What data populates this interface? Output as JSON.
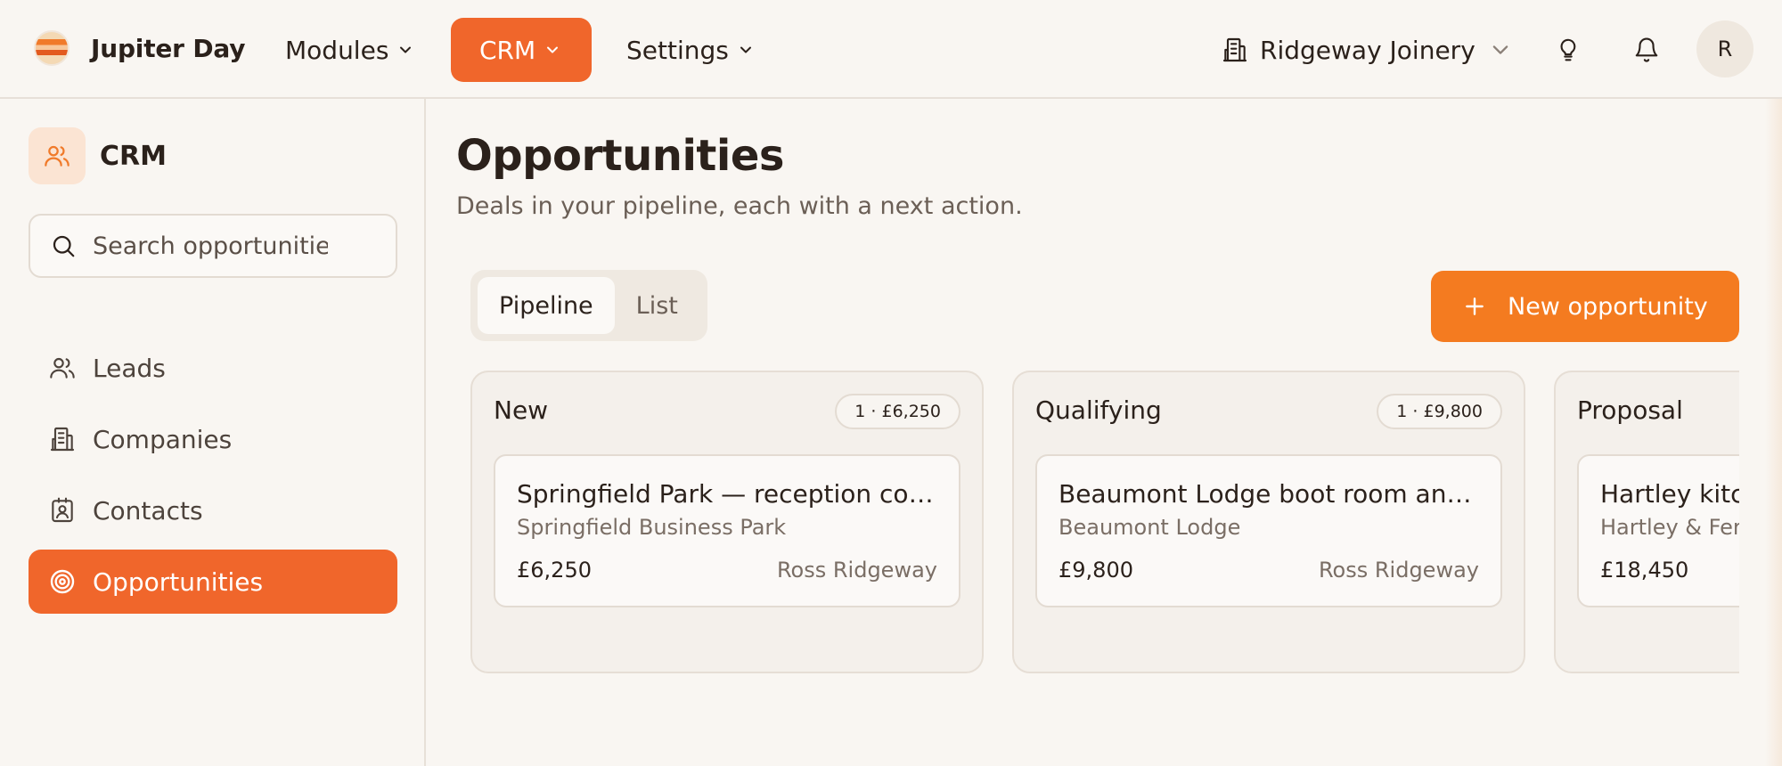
{
  "app": {
    "name": "Jupiter Day"
  },
  "topnav": {
    "items": [
      {
        "label": "Modules"
      },
      {
        "label": "CRM"
      },
      {
        "label": "Settings"
      }
    ],
    "org_name": "Ridgeway Joinery",
    "avatar_initial": "R"
  },
  "sidebar": {
    "title": "CRM",
    "search_placeholder": "Search opportunities",
    "items": [
      {
        "label": "Leads",
        "icon": "users-icon"
      },
      {
        "label": "Companies",
        "icon": "building-icon"
      },
      {
        "label": "Contacts",
        "icon": "contact-card-icon"
      },
      {
        "label": "Opportunities",
        "icon": "target-icon",
        "active": true
      }
    ]
  },
  "page": {
    "title": "Opportunities",
    "subtitle": "Deals in your pipeline, each with a next action.",
    "view_tabs": [
      {
        "label": "Pipeline",
        "active": true
      },
      {
        "label": "List",
        "active": false
      }
    ],
    "new_button_label": "New opportunity"
  },
  "pipeline": {
    "columns": [
      {
        "name": "New",
        "badge": "1 · £6,250",
        "cards": [
          {
            "title": "Springfield Park — reception counter",
            "company": "Springfield Business Park",
            "value": "£6,250",
            "owner": "Ross Ridgeway"
          }
        ]
      },
      {
        "name": "Qualifying",
        "badge": "1 · £9,800",
        "cards": [
          {
            "title": "Beaumont Lodge boot room and pantry",
            "company": "Beaumont Lodge",
            "value": "£9,800",
            "owner": "Ross Ridgeway"
          }
        ]
      },
      {
        "name": "Proposal",
        "badge": "",
        "cards": [
          {
            "title": "Hartley kitchen",
            "company": "Hartley & Ferr",
            "value": "£18,450",
            "owner": ""
          }
        ]
      }
    ]
  },
  "colors": {
    "accent": "#f0662b",
    "primary_button": "#f47b20",
    "background": "#f9f6f2",
    "text": "#2b211b"
  }
}
